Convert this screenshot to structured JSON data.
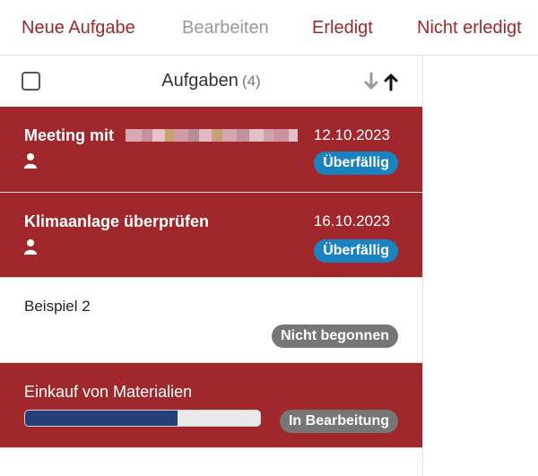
{
  "toolbar": {
    "buttons": [
      {
        "label": "Neue Aufgabe",
        "enabled": true
      },
      {
        "label": "Bearbeiten",
        "enabled": false
      },
      {
        "label": "Erledigt",
        "enabled": true
      },
      {
        "label": "Nicht erledigt",
        "enabled": true
      }
    ]
  },
  "list": {
    "title": "Aufgaben",
    "count": "(4)",
    "sort_icon": "sort-arrows-icon",
    "tasks": [
      {
        "title": "Meeting mit",
        "date": "12.10.2023",
        "status": "Überfällig",
        "status_color": "#1b82c0",
        "icon": "user-icon",
        "title_redacted": true
      },
      {
        "title": "Klimaanlage überprüfen",
        "date": "16.10.2023",
        "status": "Überfällig",
        "status_color": "#1b82c0",
        "icon": "user-icon"
      },
      {
        "title": "Beispiel 2",
        "status": "Nicht begonnen",
        "status_color": "#767676"
      },
      {
        "title": "Einkauf von Materialien",
        "status": "In Bearbeitung",
        "status_color": "#767676",
        "progress": 0.65
      }
    ]
  },
  "colors": {
    "accent": "#a0282d",
    "row_highlight": "#a0282d",
    "progress_fill": "#273f78",
    "badge_blue": "#1b82c0",
    "badge_gray": "#767676"
  }
}
